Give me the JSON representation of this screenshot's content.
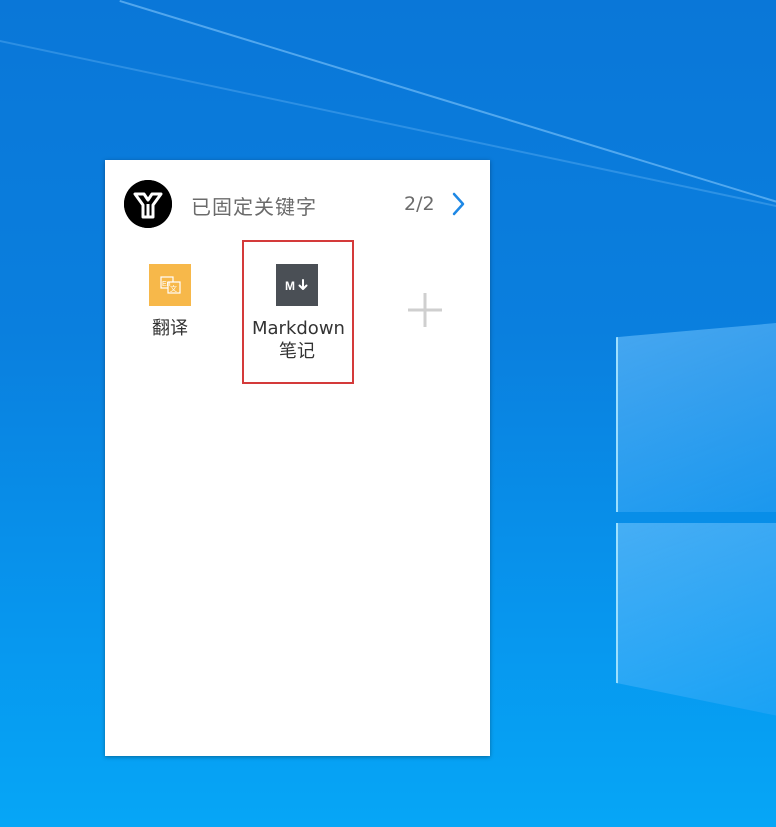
{
  "panel": {
    "title": "已固定关键字",
    "page_indicator": "2/2",
    "items": [
      {
        "label": "翻译",
        "icon": "translate-icon",
        "icon_text": "En",
        "color": "#f7b84a"
      },
      {
        "label_line1": "Markdown",
        "label_line2": "笔记",
        "icon": "markdown-icon",
        "icon_text": "M↓",
        "color": "#4a4f55",
        "selected": true
      }
    ],
    "add_icon": "plus-icon"
  },
  "colors": {
    "desktop_top": "#0a77d8",
    "desktop_bottom": "#06a6f6",
    "selection": "#d43a3a",
    "accent": "#1e88e5"
  }
}
